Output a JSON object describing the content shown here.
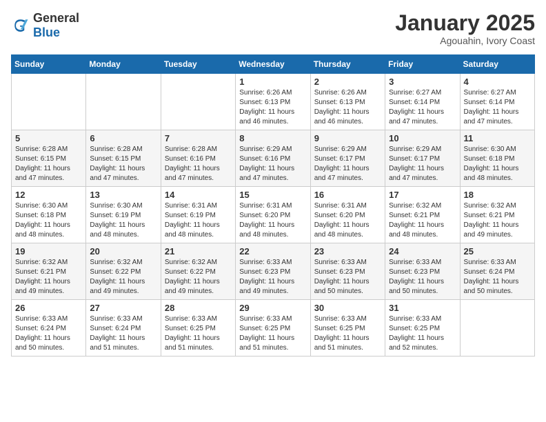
{
  "logo": {
    "general": "General",
    "blue": "Blue"
  },
  "header": {
    "month": "January 2025",
    "location": "Agouahin, Ivory Coast"
  },
  "weekdays": [
    "Sunday",
    "Monday",
    "Tuesday",
    "Wednesday",
    "Thursday",
    "Friday",
    "Saturday"
  ],
  "weeks": [
    [
      {
        "day": "",
        "sunrise": "",
        "sunset": "",
        "daylight": ""
      },
      {
        "day": "",
        "sunrise": "",
        "sunset": "",
        "daylight": ""
      },
      {
        "day": "",
        "sunrise": "",
        "sunset": "",
        "daylight": ""
      },
      {
        "day": "1",
        "sunrise": "Sunrise: 6:26 AM",
        "sunset": "Sunset: 6:13 PM",
        "daylight": "Daylight: 11 hours and 46 minutes."
      },
      {
        "day": "2",
        "sunrise": "Sunrise: 6:26 AM",
        "sunset": "Sunset: 6:13 PM",
        "daylight": "Daylight: 11 hours and 46 minutes."
      },
      {
        "day": "3",
        "sunrise": "Sunrise: 6:27 AM",
        "sunset": "Sunset: 6:14 PM",
        "daylight": "Daylight: 11 hours and 47 minutes."
      },
      {
        "day": "4",
        "sunrise": "Sunrise: 6:27 AM",
        "sunset": "Sunset: 6:14 PM",
        "daylight": "Daylight: 11 hours and 47 minutes."
      }
    ],
    [
      {
        "day": "5",
        "sunrise": "Sunrise: 6:28 AM",
        "sunset": "Sunset: 6:15 PM",
        "daylight": "Daylight: 11 hours and 47 minutes."
      },
      {
        "day": "6",
        "sunrise": "Sunrise: 6:28 AM",
        "sunset": "Sunset: 6:15 PM",
        "daylight": "Daylight: 11 hours and 47 minutes."
      },
      {
        "day": "7",
        "sunrise": "Sunrise: 6:28 AM",
        "sunset": "Sunset: 6:16 PM",
        "daylight": "Daylight: 11 hours and 47 minutes."
      },
      {
        "day": "8",
        "sunrise": "Sunrise: 6:29 AM",
        "sunset": "Sunset: 6:16 PM",
        "daylight": "Daylight: 11 hours and 47 minutes."
      },
      {
        "day": "9",
        "sunrise": "Sunrise: 6:29 AM",
        "sunset": "Sunset: 6:17 PM",
        "daylight": "Daylight: 11 hours and 47 minutes."
      },
      {
        "day": "10",
        "sunrise": "Sunrise: 6:29 AM",
        "sunset": "Sunset: 6:17 PM",
        "daylight": "Daylight: 11 hours and 47 minutes."
      },
      {
        "day": "11",
        "sunrise": "Sunrise: 6:30 AM",
        "sunset": "Sunset: 6:18 PM",
        "daylight": "Daylight: 11 hours and 48 minutes."
      }
    ],
    [
      {
        "day": "12",
        "sunrise": "Sunrise: 6:30 AM",
        "sunset": "Sunset: 6:18 PM",
        "daylight": "Daylight: 11 hours and 48 minutes."
      },
      {
        "day": "13",
        "sunrise": "Sunrise: 6:30 AM",
        "sunset": "Sunset: 6:19 PM",
        "daylight": "Daylight: 11 hours and 48 minutes."
      },
      {
        "day": "14",
        "sunrise": "Sunrise: 6:31 AM",
        "sunset": "Sunset: 6:19 PM",
        "daylight": "Daylight: 11 hours and 48 minutes."
      },
      {
        "day": "15",
        "sunrise": "Sunrise: 6:31 AM",
        "sunset": "Sunset: 6:20 PM",
        "daylight": "Daylight: 11 hours and 48 minutes."
      },
      {
        "day": "16",
        "sunrise": "Sunrise: 6:31 AM",
        "sunset": "Sunset: 6:20 PM",
        "daylight": "Daylight: 11 hours and 48 minutes."
      },
      {
        "day": "17",
        "sunrise": "Sunrise: 6:32 AM",
        "sunset": "Sunset: 6:21 PM",
        "daylight": "Daylight: 11 hours and 48 minutes."
      },
      {
        "day": "18",
        "sunrise": "Sunrise: 6:32 AM",
        "sunset": "Sunset: 6:21 PM",
        "daylight": "Daylight: 11 hours and 49 minutes."
      }
    ],
    [
      {
        "day": "19",
        "sunrise": "Sunrise: 6:32 AM",
        "sunset": "Sunset: 6:21 PM",
        "daylight": "Daylight: 11 hours and 49 minutes."
      },
      {
        "day": "20",
        "sunrise": "Sunrise: 6:32 AM",
        "sunset": "Sunset: 6:22 PM",
        "daylight": "Daylight: 11 hours and 49 minutes."
      },
      {
        "day": "21",
        "sunrise": "Sunrise: 6:32 AM",
        "sunset": "Sunset: 6:22 PM",
        "daylight": "Daylight: 11 hours and 49 minutes."
      },
      {
        "day": "22",
        "sunrise": "Sunrise: 6:33 AM",
        "sunset": "Sunset: 6:23 PM",
        "daylight": "Daylight: 11 hours and 49 minutes."
      },
      {
        "day": "23",
        "sunrise": "Sunrise: 6:33 AM",
        "sunset": "Sunset: 6:23 PM",
        "daylight": "Daylight: 11 hours and 50 minutes."
      },
      {
        "day": "24",
        "sunrise": "Sunrise: 6:33 AM",
        "sunset": "Sunset: 6:23 PM",
        "daylight": "Daylight: 11 hours and 50 minutes."
      },
      {
        "day": "25",
        "sunrise": "Sunrise: 6:33 AM",
        "sunset": "Sunset: 6:24 PM",
        "daylight": "Daylight: 11 hours and 50 minutes."
      }
    ],
    [
      {
        "day": "26",
        "sunrise": "Sunrise: 6:33 AM",
        "sunset": "Sunset: 6:24 PM",
        "daylight": "Daylight: 11 hours and 50 minutes."
      },
      {
        "day": "27",
        "sunrise": "Sunrise: 6:33 AM",
        "sunset": "Sunset: 6:24 PM",
        "daylight": "Daylight: 11 hours and 51 minutes."
      },
      {
        "day": "28",
        "sunrise": "Sunrise: 6:33 AM",
        "sunset": "Sunset: 6:25 PM",
        "daylight": "Daylight: 11 hours and 51 minutes."
      },
      {
        "day": "29",
        "sunrise": "Sunrise: 6:33 AM",
        "sunset": "Sunset: 6:25 PM",
        "daylight": "Daylight: 11 hours and 51 minutes."
      },
      {
        "day": "30",
        "sunrise": "Sunrise: 6:33 AM",
        "sunset": "Sunset: 6:25 PM",
        "daylight": "Daylight: 11 hours and 51 minutes."
      },
      {
        "day": "31",
        "sunrise": "Sunrise: 6:33 AM",
        "sunset": "Sunset: 6:25 PM",
        "daylight": "Daylight: 11 hours and 52 minutes."
      },
      {
        "day": "",
        "sunrise": "",
        "sunset": "",
        "daylight": ""
      }
    ]
  ]
}
